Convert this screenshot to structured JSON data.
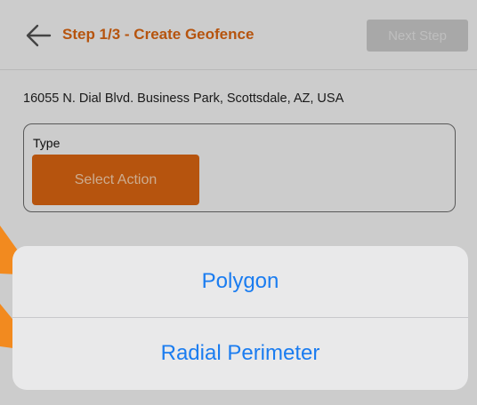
{
  "header": {
    "title": "Step 1/3 - Create Geofence",
    "next_label": "Next Step"
  },
  "address": "16055 N. Dial Blvd. Business Park, Scottsdale, AZ, USA",
  "type_field": {
    "label": "Type",
    "button_label": "Select Action"
  },
  "action_sheet": {
    "options": [
      {
        "label": "Polygon"
      },
      {
        "label": "Radial Perimeter"
      }
    ]
  },
  "colors": {
    "accent": "#e46a12",
    "link": "#1a7cf0",
    "disabled": "#d2d2d2"
  },
  "icons": {
    "back": "arrow-left-icon"
  }
}
